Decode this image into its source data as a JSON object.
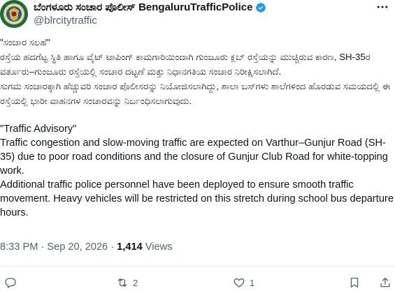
{
  "author": {
    "display_name": "ಬೆಂಗಳೂರು ಸಂಚಾರ ಪೊಲೀಸ್ BengaluruTrafficPolice",
    "handle": "@blrcitytraffic",
    "verified": true
  },
  "tweet": {
    "kannada_title": "\"ಸಂಚಾರ ಸಲಹೆ\"",
    "kannada_p1": "ರಸ್ತೆಯ ಹದಗೆಟ್ಟ ಸ್ಥಿತಿ ಹಾಗೂ ವೈಟ್ ಟಾಪಿಂಗ್ ಕಾಮಗಾರಿಯಿಂದಾಗಿ ಗುಂಜೂರು ಕ್ಲಬ್ ರಸ್ತೆಯನ್ನು ಮುಚ್ಚಿರುವ ಕಾರಣ, SH-35ರ ವರ್ತೂರು–ಗುಂಜೂರು ರಸ್ತೆಯಲ್ಲಿ ಸಂಚಾರ ದಟ್ಟಣೆ ಮತ್ತು ನಿಧಾನಗತಿಯ ಸಂಚಾರ ನಿರೀಕ್ಷಿಸಲಾಗಿದೆ.",
    "kannada_p2": "ಸುಗಮ ಸಂಚಾರಕ್ಕಾಗಿ ಹೆಚ್ಚುವರಿ ಸಂಚಾರ ಪೊಲೀಸರನ್ನು ನಿಯೋಜಿಸಲಾಗಿದ್ದು, ಶಾಲಾ ಬಸ್‌ಗಳು ಶಾಲೆಗಳಿಂದ ಹೊರಡುವ ಸಮಯದಲ್ಲಿ ಈ ರಸ್ತೆಯಲ್ಲಿ ಭಾರೀ ವಾಹನಗಳ ಸಂಚಾರವನ್ನು ನಿರ್ಬಂಧಿಸಲಾಗುವುದು.",
    "english_title": "\"Traffic Advisory\"",
    "english_p1": "Traffic congestion and slow-moving traffic are expected on Varthur–Gunjur Road (SH-35) due to poor road conditions and the closure of Gunjur Club Road for white-topping work.",
    "english_p2": "Additional traffic police personnel have been deployed to ensure smooth traffic movement. Heavy vehicles will be restricted on this stretch during school bus departure hours."
  },
  "meta": {
    "time": "8:33 PM",
    "separator": " · ",
    "date": "Sep 20, 2026",
    "views_count": "1,414",
    "views_label": " Views"
  },
  "actions": {
    "replies": "",
    "reposts": "2",
    "likes": "1"
  },
  "colors": {
    "text": "#0f1419",
    "secondary": "#536471",
    "verified": "#1d9bf0",
    "divider": "#eff3f4"
  },
  "icons": [
    "police-logo-avatar",
    "verified-badge-icon",
    "more-icon",
    "reply-icon",
    "repost-icon",
    "like-icon",
    "bookmark-icon",
    "share-icon"
  ]
}
